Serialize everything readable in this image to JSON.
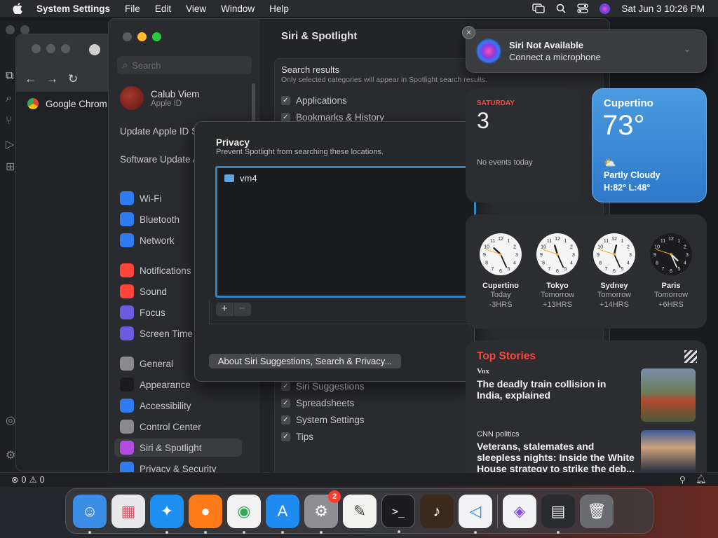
{
  "menubar": {
    "app_name": "System Settings",
    "menus": [
      "File",
      "Edit",
      "View",
      "Window",
      "Help"
    ],
    "clock": "Sat Jun 3  10:26 PM"
  },
  "chrome": {
    "bookmark": "Google Chrom"
  },
  "status_bar": {
    "errors": "0",
    "warnings": "0"
  },
  "settings": {
    "title": "Siri & Spotlight",
    "search_placeholder": "Search",
    "account": {
      "name": "Calub Viem",
      "sub": "Apple ID"
    },
    "links": [
      "Update Apple ID Settings",
      "Software Update Available"
    ],
    "items": [
      {
        "label": "Wi-Fi",
        "color": "#2f7cf0"
      },
      {
        "label": "Bluetooth",
        "color": "#2f7cf0"
      },
      {
        "label": "Network",
        "color": "#2f7cf0"
      },
      {
        "label": "Notifications",
        "color": "#ff453a"
      },
      {
        "label": "Sound",
        "color": "#ff453a"
      },
      {
        "label": "Focus",
        "color": "#6e5ae0"
      },
      {
        "label": "Screen Time",
        "color": "#6e5ae0"
      },
      {
        "label": "General",
        "color": "#8a8a8d"
      },
      {
        "label": "Appearance",
        "color": "#1c1c1e"
      },
      {
        "label": "Accessibility",
        "color": "#2f7cf0"
      },
      {
        "label": "Control Center",
        "color": "#8a8a8d"
      },
      {
        "label": "Siri & Spotlight",
        "color": "#b04ce0"
      },
      {
        "label": "Privacy & Security",
        "color": "#2f7cf0"
      }
    ],
    "results": {
      "title": "Search results",
      "subtitle": "Only selected categories will appear in Spotlight search results.",
      "top": [
        "Applications",
        "Bookmarks & History"
      ],
      "bottom": [
        "Siri Suggestions",
        "Spreadsheets",
        "System Settings",
        "Tips"
      ]
    }
  },
  "privacy": {
    "title": "Privacy",
    "subtitle": "Prevent Spotlight from searching these locations.",
    "items": [
      "vm4"
    ],
    "add": "+",
    "remove": "−",
    "about_button": "About Siri Suggestions, Search & Privacy..."
  },
  "siri": {
    "title": "Siri Not Available",
    "subtitle": "Connect a microphone",
    "close": "×"
  },
  "calendar": {
    "day": "SATURDAY",
    "date": "3",
    "events": "No events today"
  },
  "weather": {
    "city": "Cupertino",
    "temp": "73°",
    "condition": "Partly Cloudy",
    "hilo": "H:82° L:48°"
  },
  "clocks": [
    {
      "city": "Cupertino",
      "day": "Today",
      "offset": "-3HRS",
      "hour": 10,
      "minute": 26,
      "dark": false
    },
    {
      "city": "Tokyo",
      "day": "Tomorrow",
      "offset": "+13HRS",
      "hour": 11,
      "minute": 26,
      "dark": false
    },
    {
      "city": "Sydney",
      "day": "Tomorrow",
      "offset": "+14HRS",
      "hour": 12,
      "minute": 26,
      "dark": false
    },
    {
      "city": "Paris",
      "day": "Tomorrow",
      "offset": "+6HRS",
      "hour": 4,
      "minute": 26,
      "dark": true
    }
  ],
  "news": {
    "title": "Top Stories",
    "stories": [
      {
        "source": "Vox",
        "headline": "The deadly train collision in India, explained"
      },
      {
        "source": "CNN politics",
        "headline": "Veterans, stalemates and sleepless nights: Inside the White House strategy to strike the deb..."
      }
    ]
  },
  "dock": {
    "items": [
      {
        "name": "finder",
        "color": "#3a8ee6",
        "glyph": "☺"
      },
      {
        "name": "launchpad",
        "color": "#e8e8ea",
        "glyph": "▦"
      },
      {
        "name": "safari",
        "color": "#1e8ff0",
        "glyph": "✦"
      },
      {
        "name": "firefox",
        "color": "#ff7b1a",
        "glyph": "●"
      },
      {
        "name": "chrome",
        "color": "#f2f2f2",
        "glyph": "◉"
      },
      {
        "name": "app-store",
        "color": "#1f8af0",
        "glyph": "A"
      },
      {
        "name": "system-settings",
        "color": "#8e8e93",
        "glyph": "⚙"
      },
      {
        "name": "textedit",
        "color": "#f2f2f0",
        "glyph": "✎"
      },
      {
        "name": "terminal",
        "color": "#1c1c1e",
        "glyph": ">_"
      },
      {
        "name": "garageband",
        "color": "#3a2a1a",
        "glyph": "♪"
      },
      {
        "name": "vscode",
        "color": "#f2f2f4",
        "glyph": "◁"
      },
      {
        "name": "visual-studio",
        "color": "#f2f2f4",
        "glyph": "◈"
      },
      {
        "name": "recent-window",
        "color": "#2a2b2e",
        "glyph": "▤"
      },
      {
        "name": "trash",
        "color": "#6a6b6e",
        "glyph": "🗑"
      }
    ],
    "settings_badge": "2"
  }
}
